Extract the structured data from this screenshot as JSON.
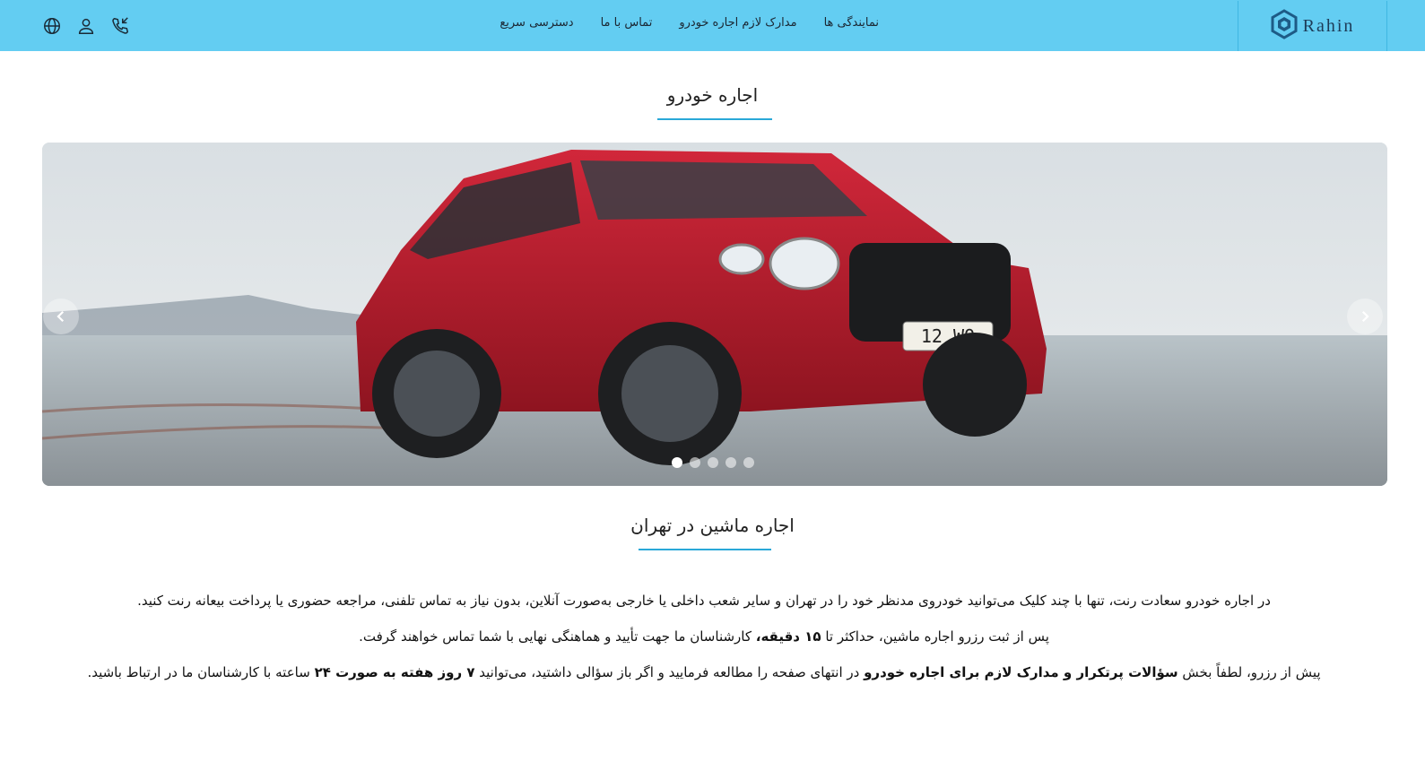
{
  "header": {
    "logo_text": "Rahin",
    "nav": [
      {
        "label": "نمایندگی ها"
      },
      {
        "label": "مدارک لازم اجاره خودرو"
      },
      {
        "label": "تماس با ما"
      },
      {
        "label": "دسترسی سریع"
      }
    ],
    "icons": [
      "globe-icon",
      "user-icon",
      "phone-icon"
    ],
    "background_color": "#63cdf2"
  },
  "hero": {
    "title": "اجاره خودرو",
    "slide_count": 5,
    "active_slide": 1,
    "image_alt": "red SUV on wet beach",
    "plate_text": "12 WO"
  },
  "section": {
    "title": "اجاره ماشین در تهران",
    "p1": "در اجاره خودرو سعادت رنت، تنها با چند کلیک می‌توانید خودروی مدنظر خود را در تهران و سایر شعب داخلی یا خارجی به‌صورت آنلاین، بدون نیاز به تماس تلفنی، مراجعه حضوری یا پرداخت بیعانه رنت کنید.",
    "p2_a": "پس از ثبت رزرو اجاره ماشین، حداکثر تا ",
    "p2_b": "۱۵ دقیقه،",
    "p2_c": " کارشناسان ما جهت تأیید و هماهنگی نهایی با شما تماس خواهند گرفت.",
    "p3_a": "پیش از رزرو، لطفاً بخش ",
    "p3_b": "سؤالات پرتکرار و مدارک لازم برای اجاره خودرو",
    "p3_c": " در انتهای صفحه را مطالعه فرمایید و اگر باز سؤالی داشتید، می‌توانید ",
    "p3_d": "۷ روز هفته به صورت ۲۴",
    "p3_e": " ساعته با کارشناسان ما در ارتباط باشید."
  },
  "accent_color": "#2aa8d8"
}
